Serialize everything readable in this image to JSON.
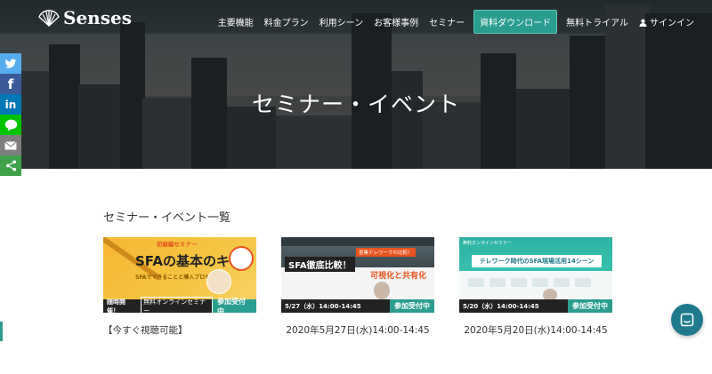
{
  "header": {
    "logo_text": "Senses",
    "nav": [
      "主要機能",
      "料金プラン",
      "利用シーン",
      "お客様事例",
      "セミナー"
    ],
    "cta_label": "資料ダウンロード",
    "trial_label": "無料トライアル",
    "signin_label": "サインイン"
  },
  "hero": {
    "title": "セミナー・イベント"
  },
  "share": {
    "twitter": "t",
    "facebook": "f",
    "linkedin": "in"
  },
  "section": {
    "title": "セミナー・イベント一覧"
  },
  "cards": [
    {
      "caption": "【今すぐ視聴可能】",
      "thumb": {
        "tag": "初級編セミナー",
        "headline": "SFAの基本のキ",
        "sub": "SFAでできることと導入プロセス",
        "badge_left": "随時開催！",
        "badge_mid": "無料オンラインセミナー",
        "badge_right": "参加受付中"
      }
    },
    {
      "caption": "2020年5月27日(水)14:00-14:45",
      "thumb": {
        "tag": "営業テレワークの比較！",
        "headline": "SFA徹底比較！",
        "sub": "可視化と共有化",
        "date": "5/27（水）14:00-14:45",
        "badge_right": "参加受付中"
      }
    },
    {
      "caption": "2020年5月20日(水)14:00-14:45",
      "thumb": {
        "tag": "無料オンラインセミナー",
        "headline": "テレワーク時代のSFA現場活用14シーン",
        "date": "5/20（水）14:00-14:45",
        "badge_right": "参加受付中"
      }
    }
  ],
  "colors": {
    "accent": "#2a9d8f",
    "hero_bg": "#3a3f42",
    "chat": "#1f7a8c"
  }
}
